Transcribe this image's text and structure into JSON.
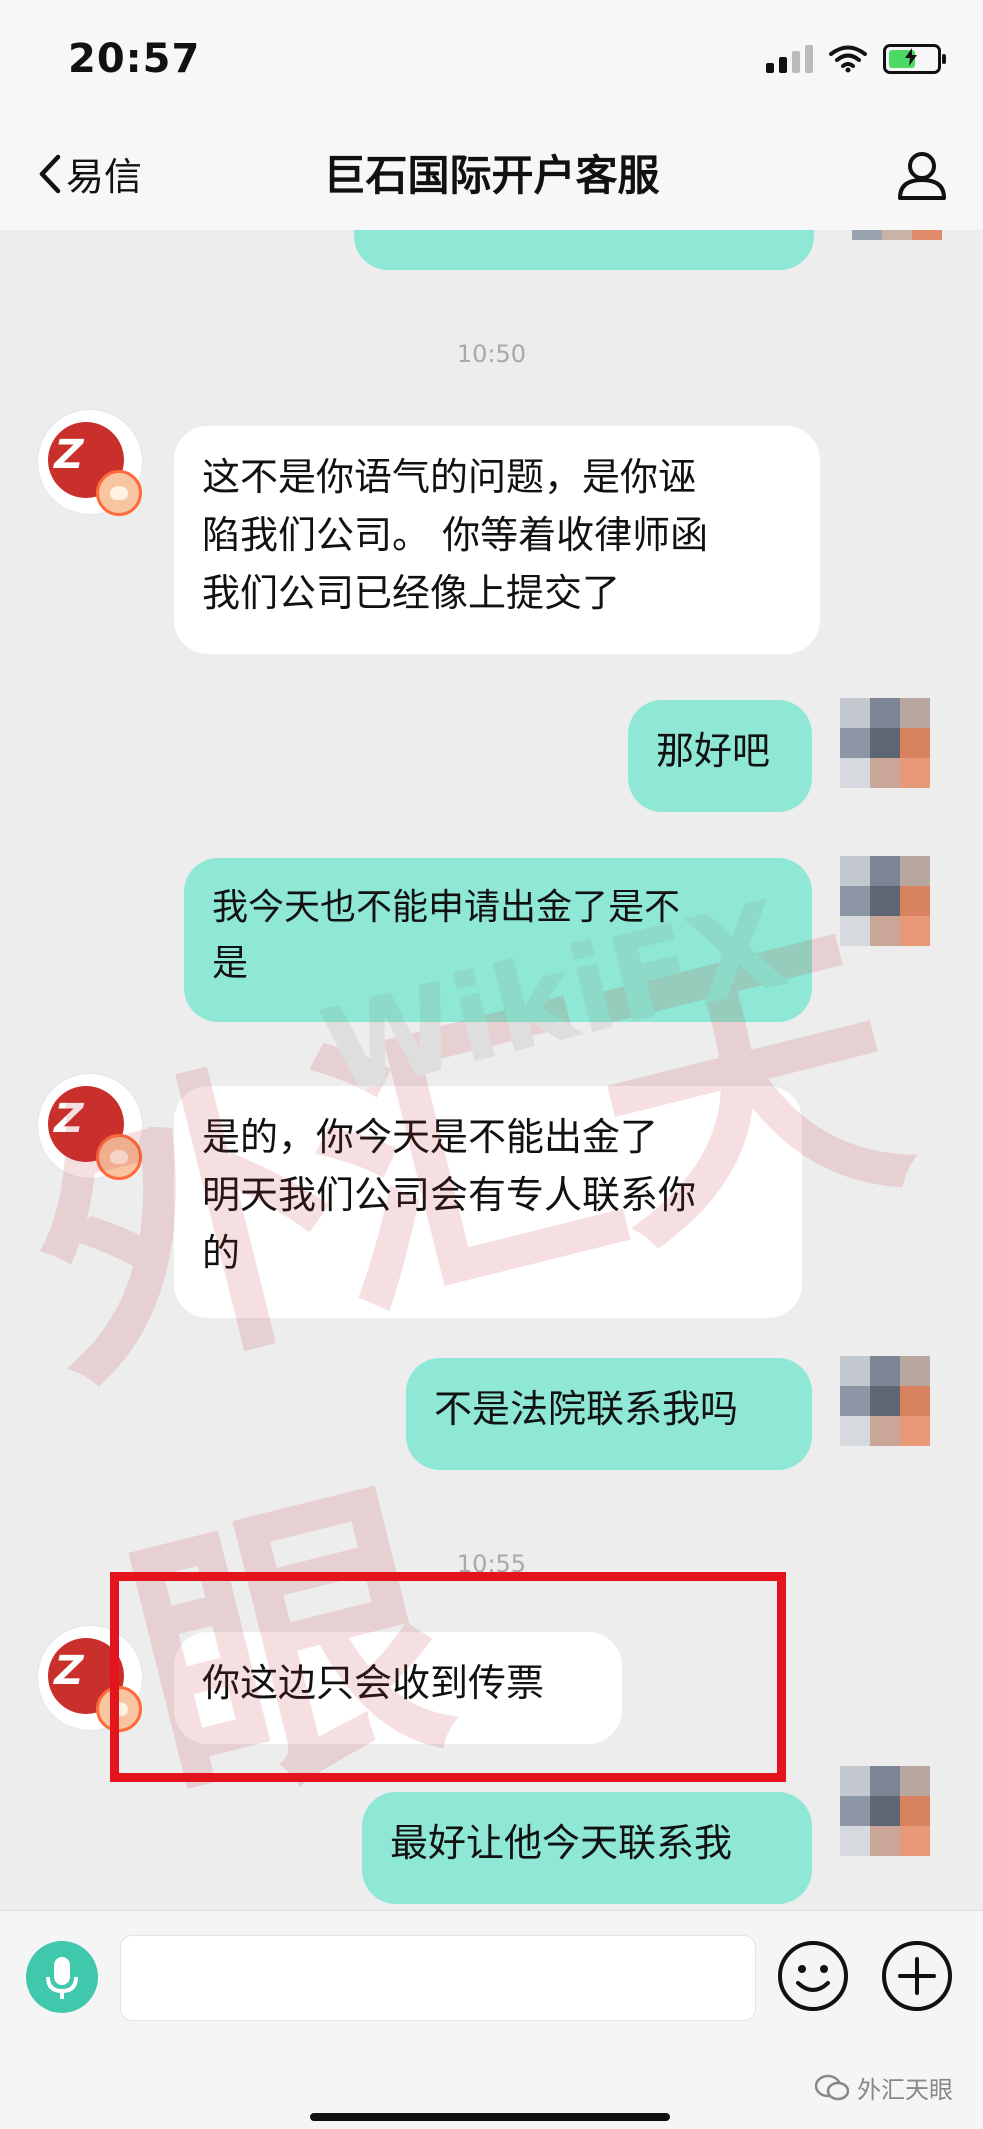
{
  "status": {
    "time": "20:57"
  },
  "nav": {
    "back_label": "易信",
    "title": "巨石国际开户客服"
  },
  "chat": {
    "separators": [
      "10:50",
      "10:55"
    ],
    "messages": [
      {
        "from": "agent",
        "text": "这不是你语气的问题，是你诬\n陷我们公司。 你等着收律师函\n我们公司已经像上提交了"
      },
      {
        "from": "user",
        "text": "那好吧"
      },
      {
        "from": "user",
        "text": "我今天也不能申请出金了是不\n是"
      },
      {
        "from": "agent",
        "text": "是的，你今天是不能出金了\n明天我们公司会有专人联系你\n的"
      },
      {
        "from": "user",
        "text": "不是法院联系我吗"
      },
      {
        "from": "agent",
        "text": "你这边只会收到传票"
      },
      {
        "from": "user",
        "text": "最好让他今天联系我"
      }
    ]
  },
  "watermark": {
    "main": "外汇天眼",
    "brand": "WikiFX"
  },
  "footer": {
    "wechat_account": "外汇天眼"
  },
  "colors": {
    "outgoing_bubble": "#8ee8d5",
    "incoming_bubble": "#ffffff",
    "highlight_border": "#e3141b",
    "accent": "#40c8ad"
  },
  "icons": [
    "chevron-left-icon",
    "contact-icon",
    "microphone-icon",
    "emoji-icon",
    "plus-icon",
    "wechat-icon"
  ]
}
